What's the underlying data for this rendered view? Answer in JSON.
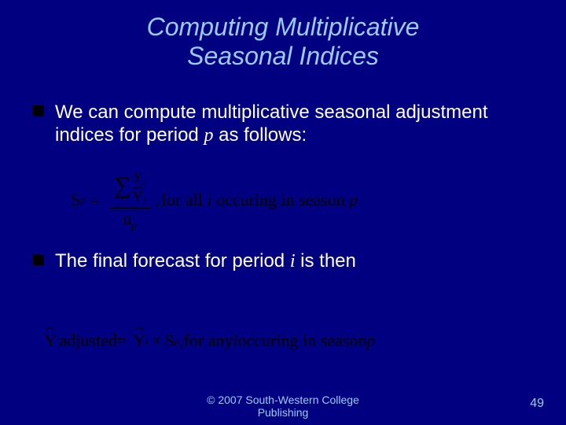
{
  "title_line1": "Computing Multiplicative",
  "title_line2": "Seasonal Indices",
  "bullet1_pre": "We can compute multiplicative seasonal adjustment indices for period ",
  "bullet1_var": "p",
  "bullet1_post": " as follows:",
  "formula1": {
    "S": "S",
    "p1": "p",
    "eq": "=",
    "sigma": "∑",
    "sigma_sub": "i",
    "Y": "Y",
    "Yi": "i",
    "Yhat": "Y",
    "Yhat_i": "i",
    "n": "n",
    "np": "p",
    "comma": ",",
    "tail": " for all ",
    "i": "i",
    "tail2": " occuring in season ",
    "p2": "p"
  },
  "bullet2_pre": "The final forecast for period ",
  "bullet2_var": "i",
  "bullet2_post": " is then",
  "formula2": {
    "Yhat": "Y",
    "i": "i",
    "adj": " adjusted ",
    "eq": "=",
    "Yhat2": "Y",
    "i2": "i",
    "times": "×",
    "S": "S",
    "p": "p",
    "comma": ",",
    "tail": " for any ",
    "ivar": "i",
    "tail2": " occuring in season ",
    "p2": "p"
  },
  "footer_line1": "© 2007 South-Western College",
  "footer_line2": "Publishing",
  "pagenum": "49"
}
